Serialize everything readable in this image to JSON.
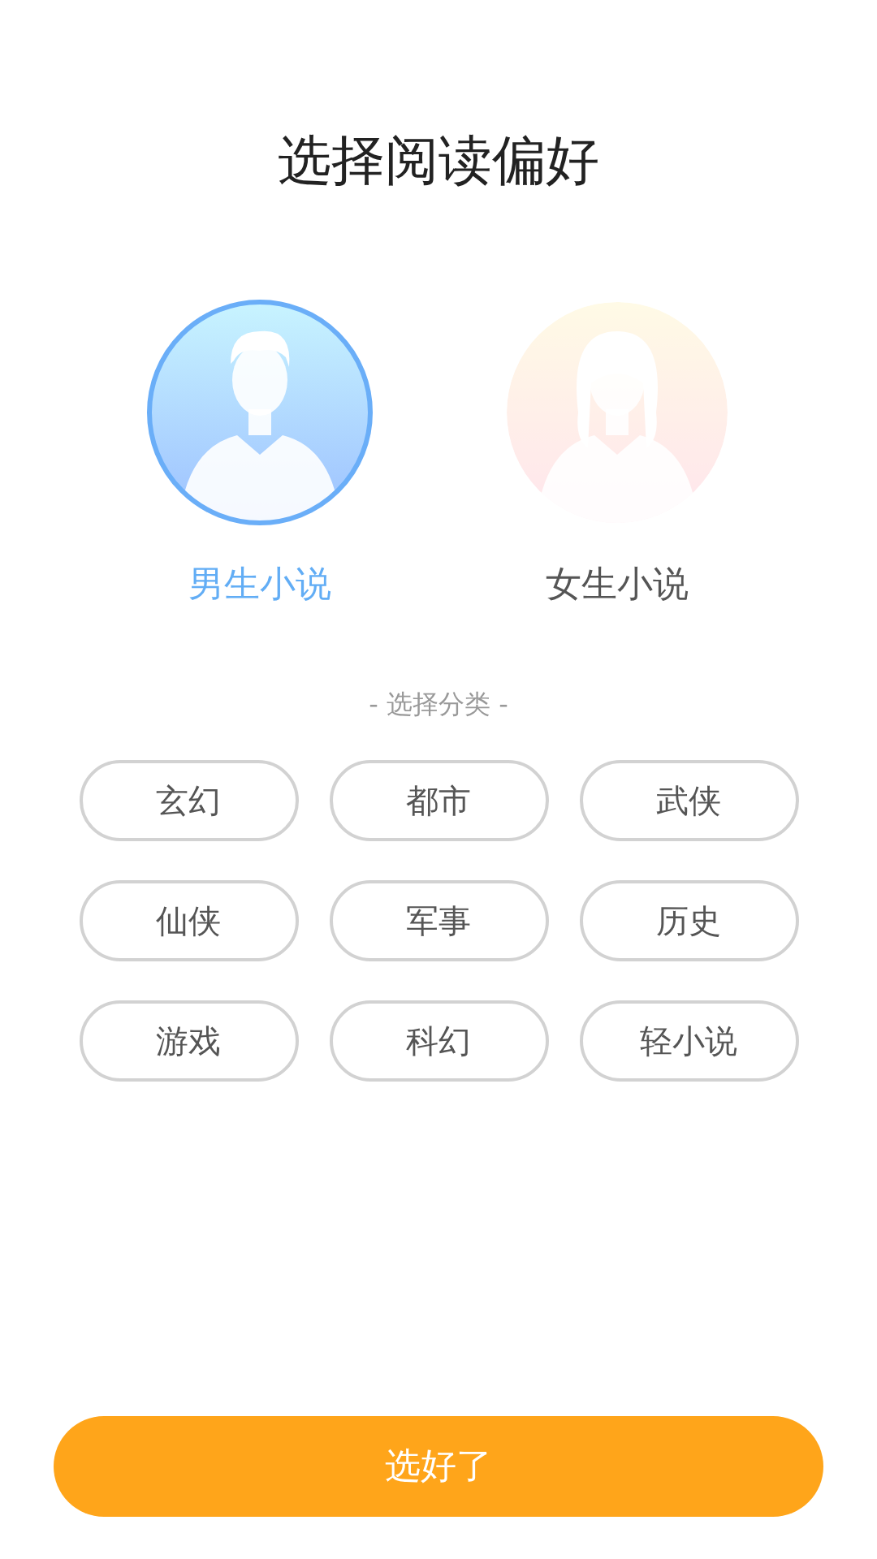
{
  "title": "选择阅读偏好",
  "genders": [
    {
      "kind": "male",
      "label": "男生小说",
      "selected": true
    },
    {
      "kind": "female",
      "label": "女生小说",
      "selected": false
    }
  ],
  "section_label": "- 选择分类 -",
  "categories": [
    {
      "label": "玄幻",
      "selected": false
    },
    {
      "label": "都市",
      "selected": false
    },
    {
      "label": "武侠",
      "selected": false
    },
    {
      "label": "仙侠",
      "selected": false
    },
    {
      "label": "军事",
      "selected": false
    },
    {
      "label": "历史",
      "selected": false
    },
    {
      "label": "游戏",
      "selected": false
    },
    {
      "label": "科幻",
      "selected": false
    },
    {
      "label": "轻小说",
      "selected": false
    }
  ],
  "confirm_button": "选好了"
}
